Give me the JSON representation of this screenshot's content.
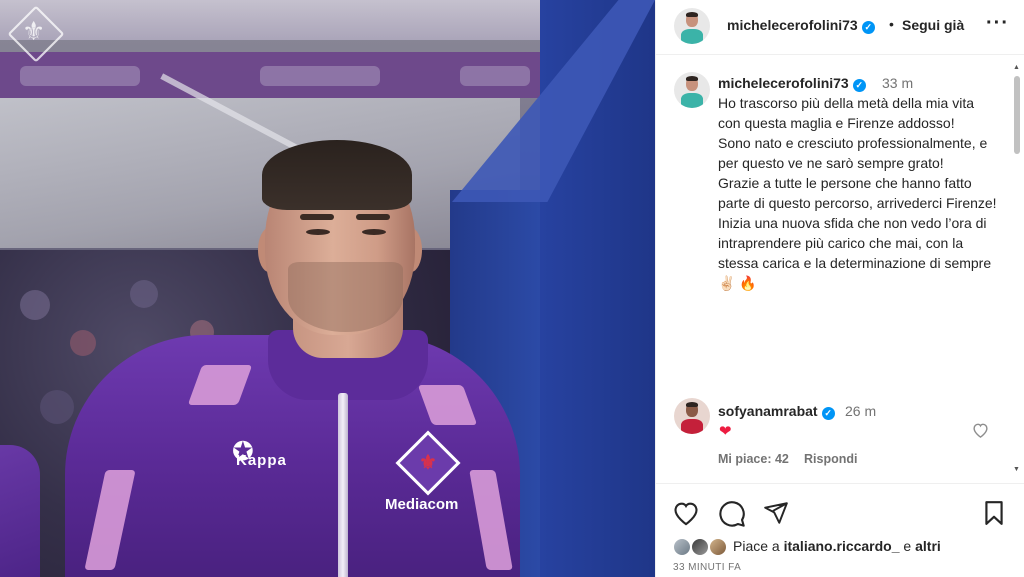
{
  "post": {
    "author": "michelecerofolini73",
    "follow_status": "Segui già",
    "more_icon": "more-icon"
  },
  "caption": {
    "author": "michelecerofolini73",
    "time": "33 m",
    "lines": [
      "Ho trascorso più della metà della mia vita con questa maglia e Firenze addosso!",
      "Sono nato e cresciuto professionalmente, e per questo ve ne sarò sempre grato!",
      "Grazie a tutte le persone che hanno fatto parte di questo percorso, arrivederci Firenze!",
      "Inizia una nuova sfida che non vedo l’ora di intraprendere più carico che mai, con la stessa carica e la determinazione di sempre ✌🏻 🔥"
    ]
  },
  "comment": {
    "author": "sofyanamrabat",
    "time": "26 m",
    "text": "❤",
    "likes": "Mi piace: 42",
    "reply": "Rispondi"
  },
  "photo": {
    "jersey_brand": "Kappa",
    "sponsor": "Mediacom"
  },
  "actions": {
    "likes_prefix": "Piace a ",
    "likes_user": "italiano.riccardo_",
    "likes_suffix": " e ",
    "likes_others": "altri",
    "posted": "33 MINUTI FA"
  },
  "colors": {
    "verified": "#0095f6",
    "jersey": "#5a2a96",
    "pillar": "#2742a0"
  }
}
